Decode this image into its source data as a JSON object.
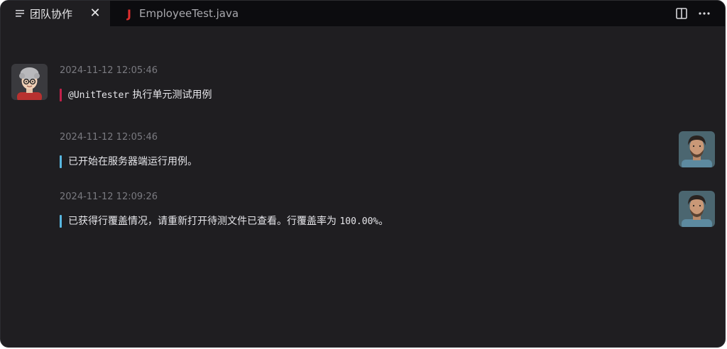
{
  "tabs": [
    {
      "label": "团队协作",
      "icon": "lines-icon",
      "active": true
    },
    {
      "label": "EmployeeTest.java",
      "icon": "java-file-icon",
      "active": false
    }
  ],
  "messages": [
    {
      "sender": "user",
      "avatar": "user-avatar",
      "time": "2024-11-12 12:05:46",
      "mention": "@UnitTester",
      "text": " 执行单元测试用例",
      "accent": "#c2204a"
    },
    {
      "sender": "agent",
      "avatar": "agent-avatar",
      "time": "2024-11-12 12:05:46",
      "text": "已开始在服务器端运行用例。",
      "accent": "#58b7e0"
    },
    {
      "sender": "agent",
      "avatar": "agent-avatar",
      "time": "2024-11-12 12:09:26",
      "text_pre": "已获得行覆盖情况，请重新打开待测文件已查看。行覆盖率为 ",
      "text_num": "100.00%",
      "text_post": "。",
      "accent": "#58b7e0"
    }
  ]
}
